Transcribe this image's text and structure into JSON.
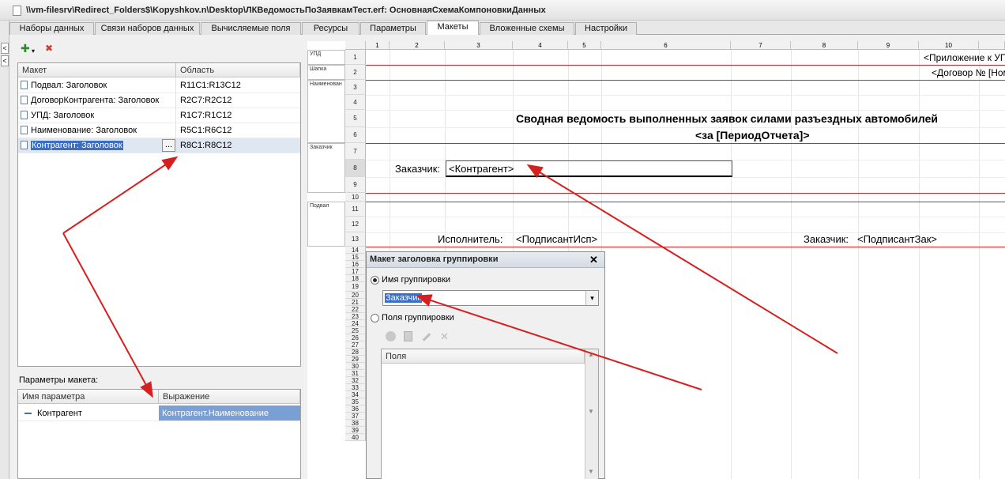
{
  "window": {
    "title": "\\\\vm-filesrv\\Redirect_Folders$\\Kopyshkov.n\\Desktop\\ЛКВедомостьПоЗаявкамТест.erf: ОсновнаяСхемаКомпоновкиДанных"
  },
  "left_strip": {
    "btn1": "<",
    "btn2": "<"
  },
  "tabs": [
    {
      "label": "Наборы данных"
    },
    {
      "label": "Связи наборов данных"
    },
    {
      "label": "Вычисляемые поля"
    },
    {
      "label": "Ресурсы"
    },
    {
      "label": "Параметры"
    },
    {
      "label": "Макеты"
    },
    {
      "label": "Вложенные схемы"
    },
    {
      "label": "Настройки"
    }
  ],
  "toolbar": {
    "add_icon": "add-icon",
    "delete_icon": "delete-icon",
    "add_glyph": "✚",
    "dropdown_glyph": "▾",
    "delete_glyph": "✖"
  },
  "layouts_table": {
    "headers": {
      "name": "Макет",
      "area": "Область"
    },
    "rows": [
      {
        "name": "Подвал: Заголовок",
        "area": "R11C1:R13C12"
      },
      {
        "name": "ДоговорКонтрагента: Заголовок",
        "area": "R2C7:R2C12"
      },
      {
        "name": "УПД: Заголовок",
        "area": "R1C7:R1C12"
      },
      {
        "name": "Наименование: Заголовок",
        "area": "R5C1:R6C12"
      },
      {
        "name": "Контрагент: Заголовок",
        "area": "R8C1:R8C12"
      }
    ],
    "ellipsis": "..."
  },
  "params": {
    "label": "Параметры макета:",
    "headers": {
      "name": "Имя параметра",
      "expr": "Выражение"
    },
    "rows": [
      {
        "name": "Контрагент",
        "expr": "Контрагент.Наименование"
      }
    ]
  },
  "sheet": {
    "columns": [
      "1",
      "2",
      "3",
      "4",
      "5",
      "6",
      "7",
      "8",
      "9",
      "10"
    ],
    "groups": {
      "upd": "УПД",
      "shapka": "Шапка",
      "naim": "Наименован",
      "zak": "Заказчик",
      "podval": "Подвал"
    },
    "rows": [
      "1",
      "2",
      "3",
      "4",
      "5",
      "6",
      "7",
      "8",
      "9",
      "10",
      "11",
      "12",
      "13",
      "14",
      "15",
      "16",
      "17",
      "18",
      "19",
      "20",
      "21",
      "22",
      "23",
      "24",
      "25",
      "26",
      "27",
      "28",
      "29",
      "30",
      "31",
      "32",
      "33",
      "34",
      "35",
      "36",
      "37",
      "38",
      "39",
      "40"
    ],
    "cells": {
      "r1": "<Приложение к УП",
      "r2": "<Договор № [Ном",
      "r5": "Сводная ведомость выполненных заявок силами разъездных автомобилей",
      "r6": "<за [ПериодОтчета]>",
      "r8_label": "Заказчик:",
      "r8_value": "<Контрагент>",
      "r13_isp": "Исполнитель:",
      "r13_isp_val": "<ПодписантИсп>",
      "r13_zak": "Заказчик:",
      "r13_zak_val": "<ПодписантЗак>"
    }
  },
  "dialog": {
    "title": "Макет заголовка группировки",
    "close": "✕",
    "radio_name": "Имя группировки",
    "group_name_value": "Заказчик",
    "radio_fields": "Поля группировки",
    "fields_header": "Поля",
    "dropdown_glyph": "▾",
    "scroll_up": "▲",
    "scroll_down": "▼"
  },
  "colors": {
    "accent": "#3a6fc4",
    "arrow": "#d62020",
    "selection": "#3a6fc4"
  }
}
